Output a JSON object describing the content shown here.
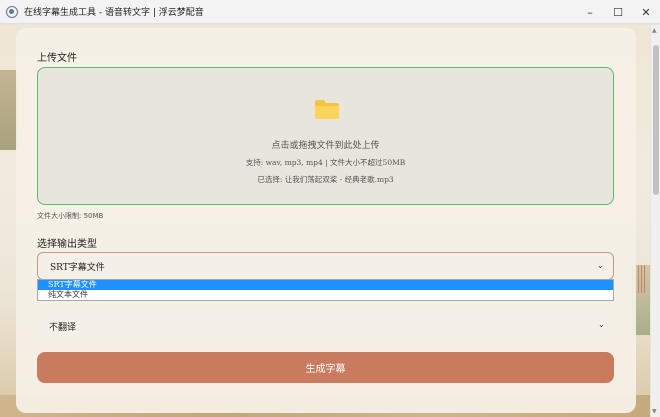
{
  "window": {
    "title": "在线字幕生成工具 - 语音转文字 | 浮云梦配音",
    "minimize": "–",
    "maximize": "☐",
    "close": "✕"
  },
  "upload": {
    "section_title": "上传文件",
    "prompt": "点击或拖拽文件到此处上传",
    "formats": "支持: wav, mp3, mp4 | 文件大小不超过50MB",
    "selected": "已选择: 让我们荡起双桨 - 经典老歌.mp3",
    "size_limit": "文件大小限制: 50MB"
  },
  "output_type": {
    "section_title": "选择输出类型",
    "selected": "SRT字幕文件",
    "options": [
      "SRT字幕文件",
      "纯文本文件"
    ]
  },
  "translate": {
    "selected": "不翻译"
  },
  "generate_label": "生成字幕",
  "colors": {
    "accent": "#c97a5f",
    "dropzone_border": "#55c06a",
    "folder": "#f5c542",
    "option_highlight": "#1e90ff"
  }
}
